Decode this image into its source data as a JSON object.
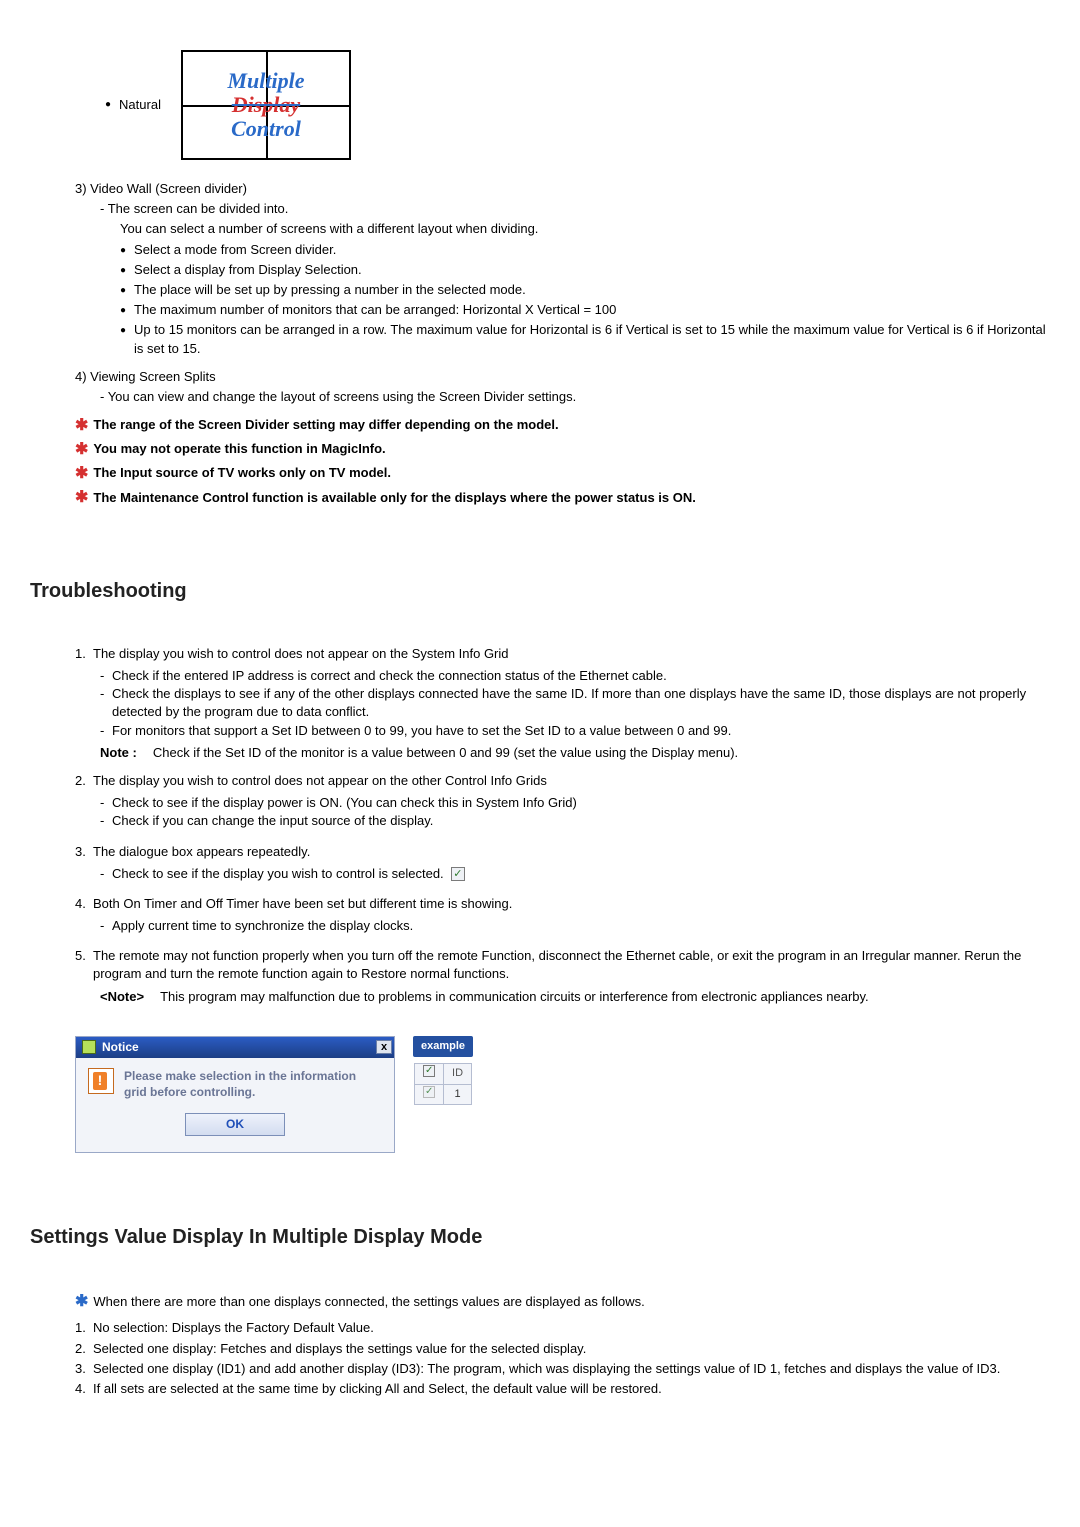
{
  "naturalLabel": "Natural",
  "multiBox": {
    "w1": "Multiple",
    "w2": "Display",
    "w3": "Control"
  },
  "section3": {
    "title": "3) Video Wall (Screen divider)",
    "line1": "- The screen can be divided into.",
    "line2": "You can select a number of screens with a different layout when dividing.",
    "b1": "Select a mode from Screen divider.",
    "b2": "Select a display from Display Selection.",
    "b3": "The place will be set up by pressing a number in the selected mode.",
    "b4": "The maximum number of monitors that can be arranged: Horizontal X Vertical = 100",
    "b5": "Up to 15 monitors can be arranged in a row. The maximum value for Horizontal is 6 if Vertical is set to 15 while the maximum value for Vertical is 6 if Horizontal is set to 15."
  },
  "section4": {
    "title": "4) Viewing Screen Splits",
    "line1": "- You can view and change the layout of screens using the Screen Divider settings."
  },
  "warnings": [
    "The range of the Screen Divider setting may differ depending on the model.",
    "You may not operate this function in MagicInfo.",
    "The Input source of TV works only on TV model.",
    "The Maintenance Control function is available only for the displays where the power status is ON."
  ],
  "trouble": {
    "heading": "Troubleshooting",
    "items": [
      {
        "num": "1.",
        "lead": "The display you wish to control does not appear on the System Info Grid",
        "subs": [
          "Check if the entered IP address is correct and check the connection status of the Ethernet cable.",
          "Check the displays to see if any of the other displays connected have the same ID. If more than one displays have the same ID, those displays are not properly detected by the program due to data conflict.",
          "For monitors that support a Set ID between 0 to 99, you have to set the Set ID to a value between 0 and 99."
        ],
        "noteLabel": "Note :",
        "noteText": "Check if the Set ID of the monitor is a value between 0 and 99 (set the value using the Display menu)."
      },
      {
        "num": "2.",
        "lead": "The display you wish to control does not appear on the other Control Info Grids",
        "subs": [
          "Check to see if the display power is ON. (You can check this in System Info Grid)",
          "Check if you can change the input source of the display."
        ]
      },
      {
        "num": "3.",
        "lead": "The dialogue box appears repeatedly.",
        "subs": [
          "Check to see if the display you wish to control is selected."
        ],
        "hasCheckIcon": true
      },
      {
        "num": "4.",
        "lead": "Both On Timer and Off Timer have been set but different time is showing.",
        "subs": [
          "Apply current time to synchronize the display clocks."
        ]
      },
      {
        "num": "5.",
        "lead": "The remote may not function properly when you turn off the remote Function, disconnect the Ethernet cable, or exit the program in an Irregular manner. Rerun the program and turn the remote function again to Restore normal functions.",
        "subs": [],
        "postNoteLabel": "<Note>",
        "postNoteText": "This program may malfunction due to problems in communication circuits or interference from electronic appliances nearby."
      }
    ]
  },
  "notice": {
    "title": "Notice",
    "close": "x",
    "msg": "Please make selection in the information grid before controlling.",
    "ok": "OK",
    "example": "example",
    "tableHead": "ID",
    "tableCell": "1"
  },
  "settingsHead": "Settings Value Display In Multiple Display Mode",
  "settingsIntro": "When there are more than one displays connected, the settings values are displayed as follows.",
  "settingsList": [
    "No selection: Displays the Factory Default Value.",
    "Selected one display: Fetches and displays the settings value for the selected display.",
    "Selected one display (ID1) and add another display (ID3): The program, which was displaying the settings value of ID 1, fetches and displays the value of ID3.",
    "If all sets are selected at the same time by clicking All and Select, the default value will be restored."
  ],
  "nums": [
    "1.",
    "2.",
    "3.",
    "4."
  ]
}
